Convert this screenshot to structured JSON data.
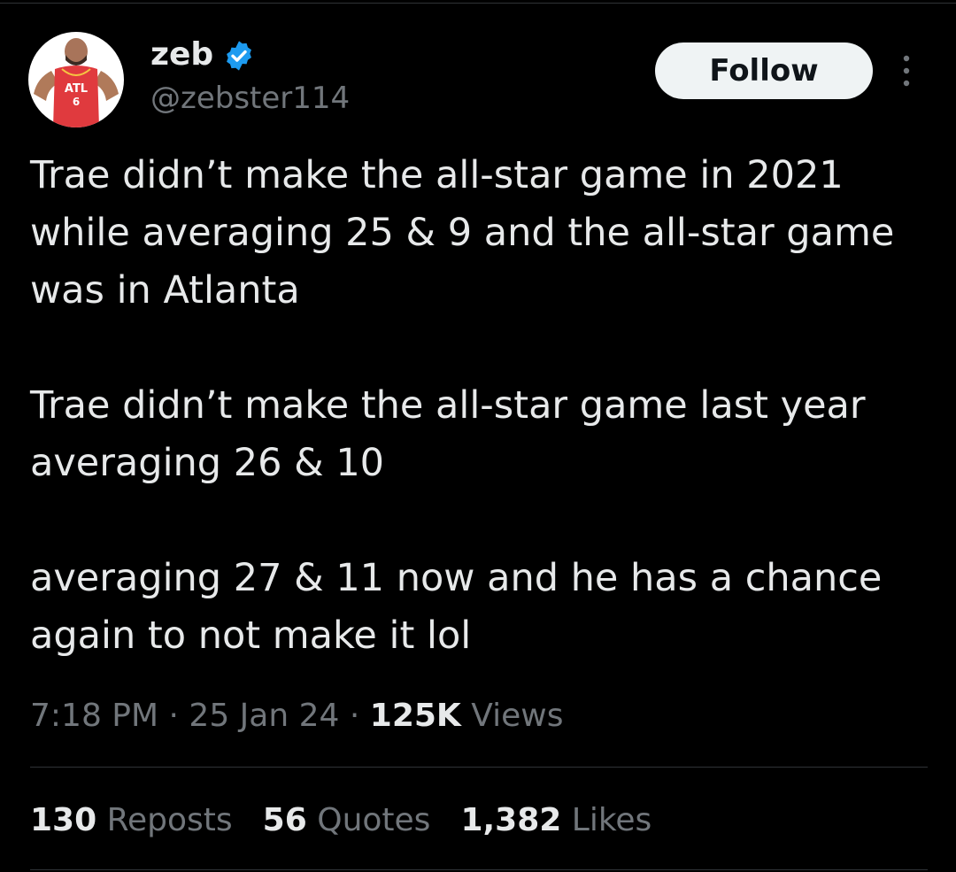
{
  "author": {
    "display_name": "zeb",
    "handle": "@zebster114",
    "verified": true,
    "avatar_jersey_text": "ATL",
    "avatar_jersey_number": "6"
  },
  "actions": {
    "follow_label": "Follow"
  },
  "tweet": {
    "paragraphs": [
      "Trae didn’t make the all-star game in 2021 while averaging 25 & 9 and the all-star game was in Atlanta",
      "Trae didn’t make the all-star game last year averaging 26 & 10",
      "averaging 27 & 11 now and he has a chance again to not make it lol"
    ],
    "time": "7:18 PM",
    "separator": "·",
    "date": "25 Jan 24",
    "views_count": "125K",
    "views_label": "Views"
  },
  "stats": {
    "reposts_count": "130",
    "reposts_label": "Reposts",
    "quotes_count": "56",
    "quotes_label": "Quotes",
    "likes_count": "1,382",
    "likes_label": "Likes"
  },
  "colors": {
    "background": "#000000",
    "primary_text": "#e7e9ea",
    "secondary_text": "#71767b",
    "verified_badge": "#1d9bf0",
    "follow_button_bg": "#eff3f4",
    "divider": "#2f3336"
  },
  "icons": {
    "verified": "verified-badge-icon",
    "more": "more-options-icon"
  }
}
